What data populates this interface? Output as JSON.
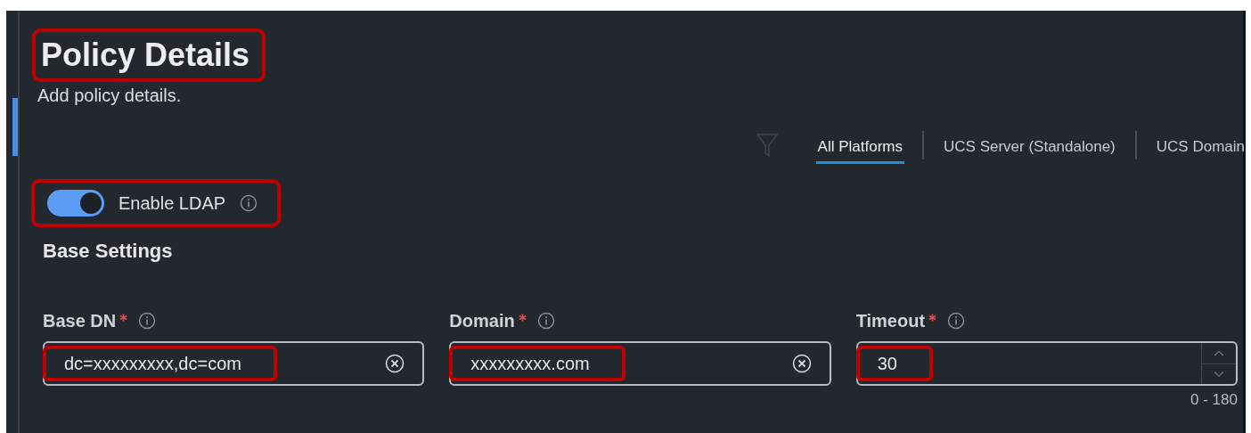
{
  "header": {
    "title": "Policy Details",
    "title_highlighted": true,
    "subtitle": "Add policy details."
  },
  "tabs": [
    {
      "label": "All Platforms",
      "selected": true
    },
    {
      "label": "UCS Server (Standalone)",
      "selected": false
    },
    {
      "label": "UCS Domain",
      "selected": false
    }
  ],
  "enable_toggle": {
    "label": "Enable LDAP",
    "on": true,
    "highlighted": true
  },
  "section_title": "Base Settings",
  "fields": [
    {
      "kind": "text",
      "label": "Base DN",
      "required": true,
      "value": "dc=xxxxxxxxx,dc=com",
      "highlighted": true
    },
    {
      "kind": "text",
      "label": "Domain",
      "required": true,
      "value": "xxxxxxxxx.com",
      "highlighted": true
    },
    {
      "kind": "number",
      "label": "Timeout",
      "required": true,
      "value": "30",
      "highlighted": true,
      "hint": "0 - 180"
    }
  ]
}
